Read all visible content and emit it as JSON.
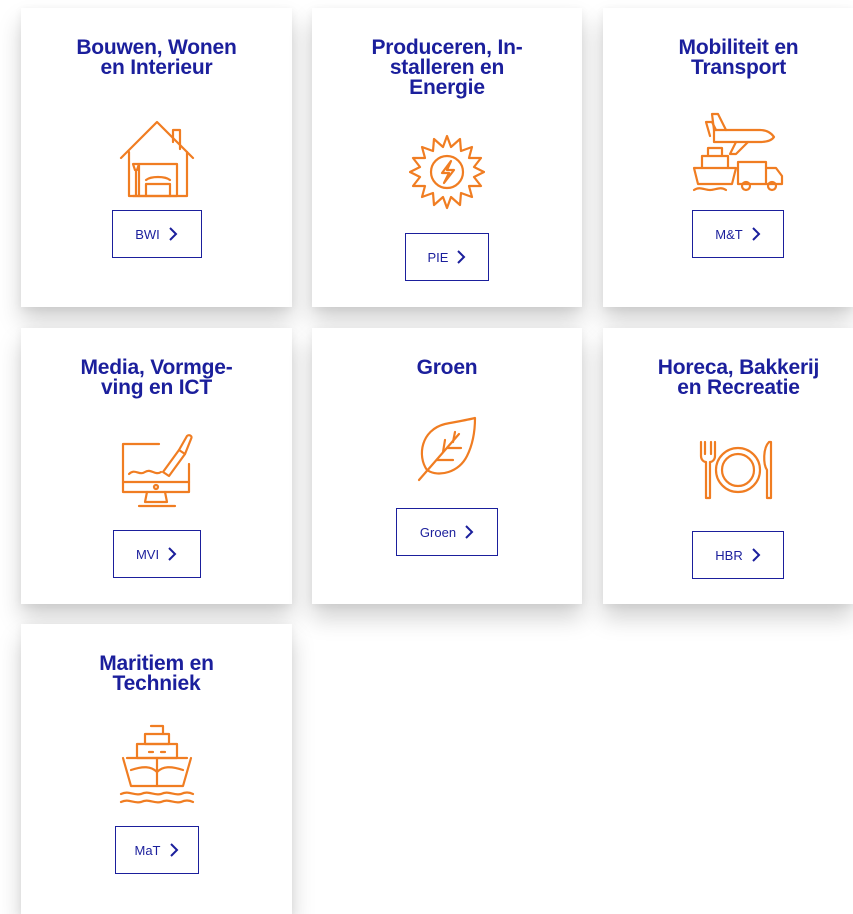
{
  "categories": [
    {
      "title_lines": [
        "Bouwen, Wonen",
        "en Interieur"
      ],
      "icon": "house-icon",
      "button_label": "BWI"
    },
    {
      "title_lines": [
        "Produceren, In-",
        "stalleren en",
        "Energie"
      ],
      "icon": "sun-energy-icon",
      "button_label": "PIE"
    },
    {
      "title_lines": [
        "Mobiliteit en",
        "Transport"
      ],
      "icon": "transport-icon",
      "button_label": "M&T"
    },
    {
      "title_lines": [
        "Media, Vormge-",
        "ving en ICT"
      ],
      "icon": "computer-paint-icon",
      "button_label": "MVI"
    },
    {
      "title_lines": [
        "Groen"
      ],
      "icon": "leaf-icon",
      "button_label": "Groen"
    },
    {
      "title_lines": [
        "Horeca, Bakkerij",
        "en Recreatie"
      ],
      "icon": "plate-cutlery-icon",
      "button_label": "HBR"
    },
    {
      "title_lines": [
        "Maritiem en",
        "Techniek"
      ],
      "icon": "ship-icon",
      "button_label": "MaT"
    }
  ],
  "colors": {
    "title": "#1b1f9c",
    "icon": "#f07d22",
    "button_border": "#1b1f9c"
  }
}
